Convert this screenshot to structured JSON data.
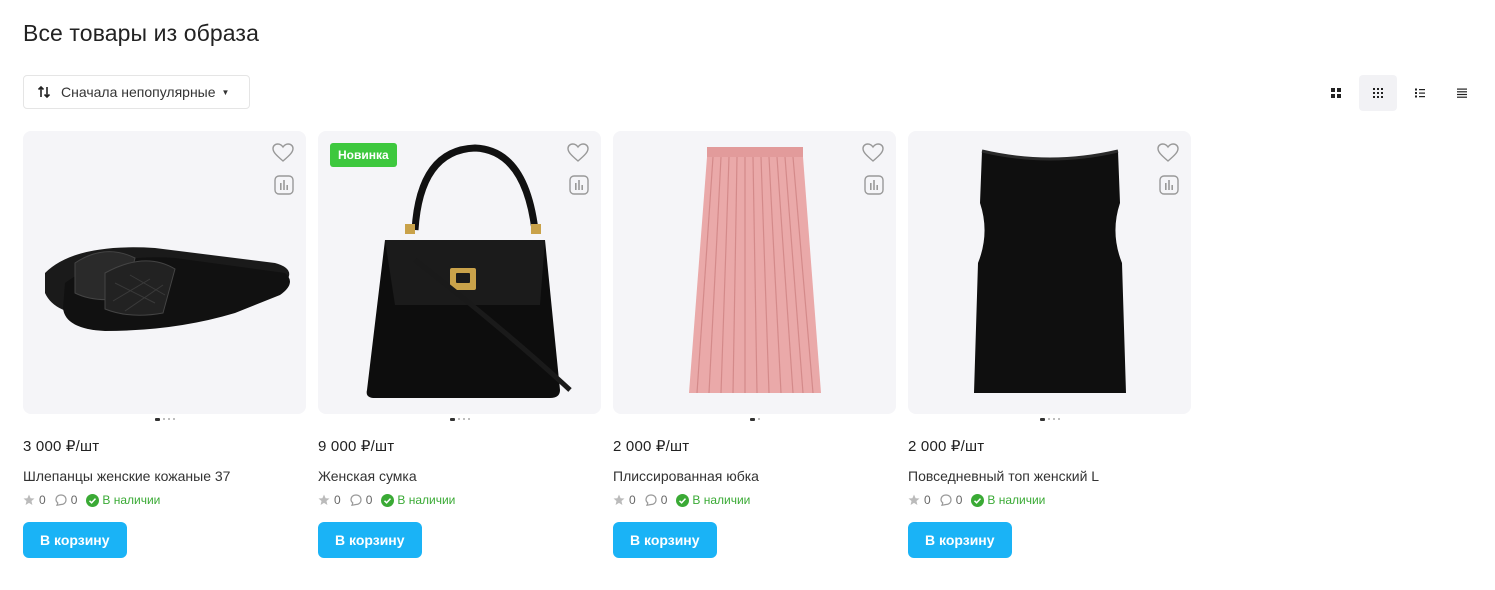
{
  "page": {
    "title": "Все товары из образа"
  },
  "sort": {
    "label": "Сначала непопулярные"
  },
  "view_modes": [
    "tiles-large",
    "tiles-small",
    "list",
    "table"
  ],
  "products": [
    {
      "name": "Шлепанцы женские кожаные 37",
      "price": "3 000 ₽/шт",
      "rating": "0",
      "reviews": "0",
      "stock": "В наличии",
      "badge": "",
      "button": "В корзину"
    },
    {
      "name": "Женская сумка",
      "price": "9 000 ₽/шт",
      "rating": "0",
      "reviews": "0",
      "stock": "В наличии",
      "badge": "Новинка",
      "button": "В корзину"
    },
    {
      "name": "Плиссированная юбка",
      "price": "2 000 ₽/шт",
      "rating": "0",
      "reviews": "0",
      "stock": "В наличии",
      "badge": "",
      "button": "В корзину"
    },
    {
      "name": "Повседневный топ женский L",
      "price": "2 000 ₽/шт",
      "rating": "0",
      "reviews": "0",
      "stock": "В наличии",
      "badge": "",
      "button": "В корзину"
    }
  ],
  "colors": {
    "accent": "#1ab3f6",
    "in_stock": "#3aaa35",
    "badge_new": "#3ec83e",
    "card_bg": "#f5f5f8"
  }
}
